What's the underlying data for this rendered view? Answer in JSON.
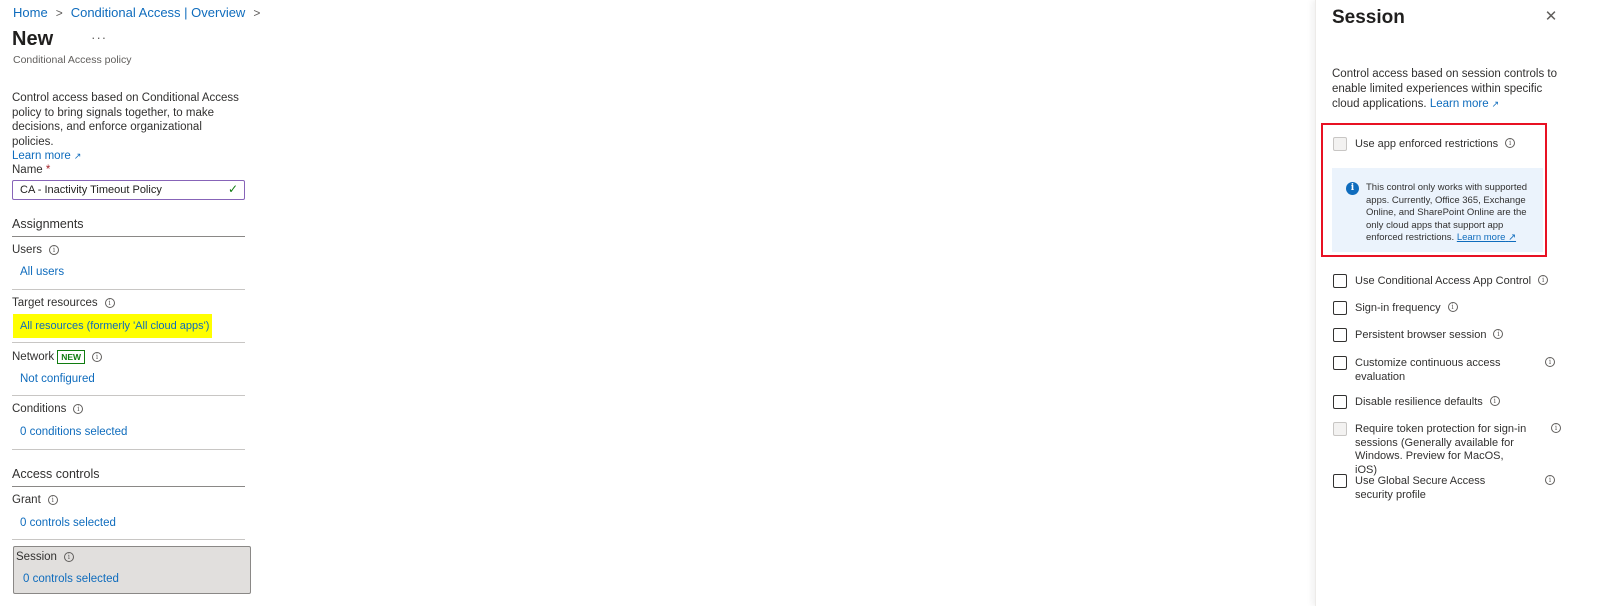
{
  "breadcrumb": {
    "home": "Home",
    "parent": "Conditional Access | Overview"
  },
  "page": {
    "title": "New",
    "more": "···",
    "subtitle": "Conditional Access policy"
  },
  "description": {
    "text": "Control access based on Conditional Access policy to bring signals together, to make decisions, and enforce organizational policies.",
    "learn_more": "Learn more"
  },
  "name_field": {
    "label": "Name",
    "required": "*",
    "value": "CA - Inactivity Timeout Policy"
  },
  "assignments": {
    "heading": "Assignments",
    "users": {
      "label": "Users",
      "value": "All users"
    },
    "target_resources": {
      "label": "Target resources",
      "value": "All resources (formerly 'All cloud apps')",
      "highlight_color": "#ffff00"
    },
    "network": {
      "label": "Network",
      "badge": "NEW",
      "value": "Not configured"
    },
    "conditions": {
      "label": "Conditions",
      "value": "0 conditions selected"
    }
  },
  "access_controls": {
    "heading": "Access controls",
    "grant": {
      "label": "Grant",
      "value": "0 controls selected"
    },
    "session": {
      "label": "Session",
      "value": "0 controls selected"
    }
  },
  "panel": {
    "title": "Session",
    "description": "Control access based on session controls to enable limited experiences within specific cloud applications.",
    "learn_more": "Learn more",
    "app_enforced": {
      "label": "Use app enforced restrictions",
      "info": "This control only works with supported apps. Currently, Office 365, Exchange Online, and SharePoint Online are the only cloud apps that support app enforced restrictions.",
      "learn_more": "Learn more"
    },
    "options": [
      {
        "label": "Use Conditional Access App Control",
        "disabled": false
      },
      {
        "label": "Sign-in frequency",
        "disabled": false
      },
      {
        "label": "Persistent browser session",
        "disabled": false
      },
      {
        "label": "Customize continuous access evaluation",
        "disabled": false
      },
      {
        "label": "Disable resilience defaults",
        "disabled": false
      },
      {
        "label": "Require token protection for sign-in sessions (Generally available for Windows. Preview for MacOS, iOS)",
        "disabled": true
      },
      {
        "label": "Use Global Secure Access security profile",
        "disabled": false
      }
    ]
  },
  "colors": {
    "link": "#0f6cbd",
    "highlight_box": "#e81123",
    "info_bar": "#ebf3fc"
  }
}
